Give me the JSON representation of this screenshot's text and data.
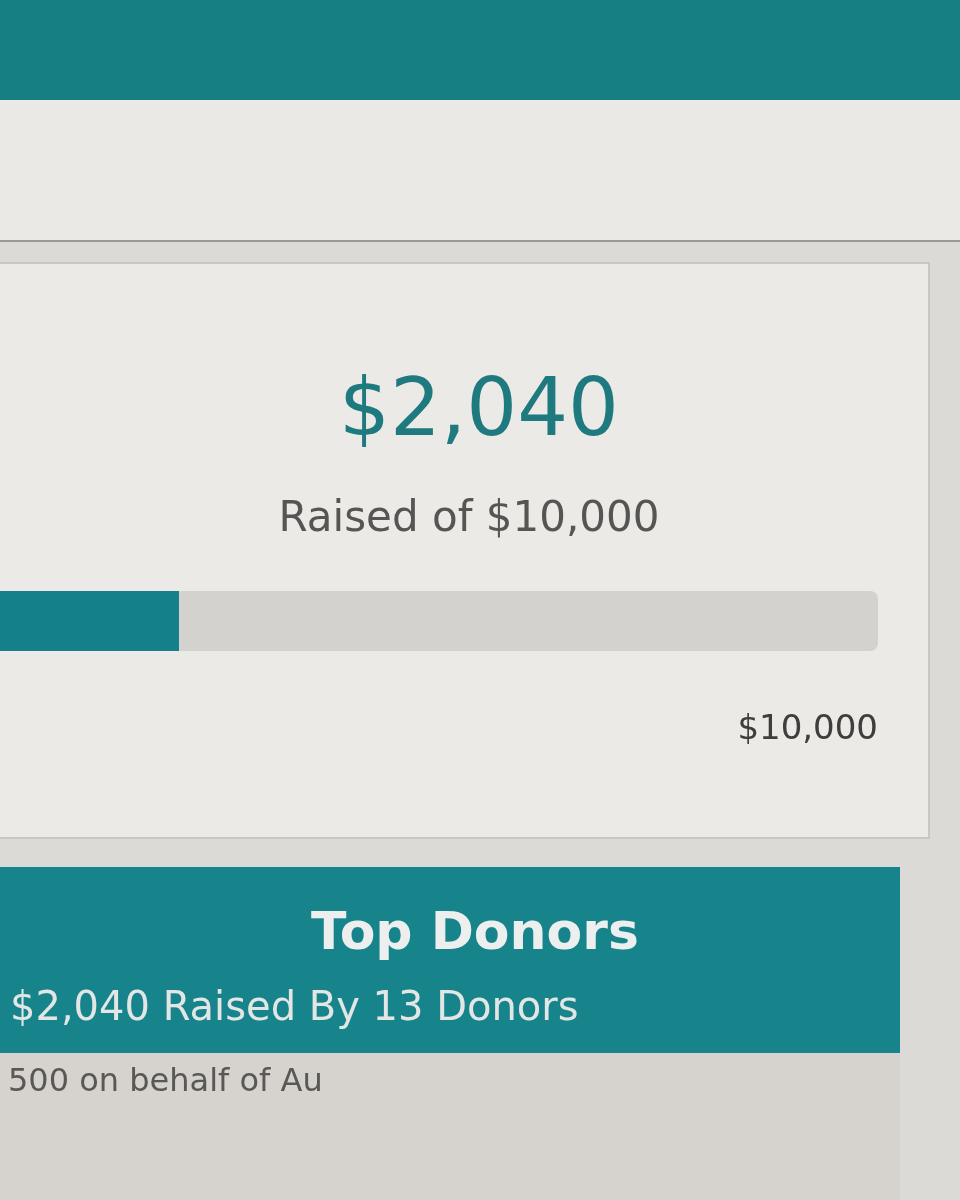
{
  "campaign": {
    "raised": "$2,040",
    "goal_text": "Raised of $10,000",
    "progress": {
      "level": 0.204,
      "end_label": "$10,000"
    }
  },
  "top_donors": {
    "title": "Top Donors",
    "summary": "$2,040 Raised By 13 Donors",
    "rows": [
      {
        "text": "500 on behalf of Au"
      }
    ]
  }
}
